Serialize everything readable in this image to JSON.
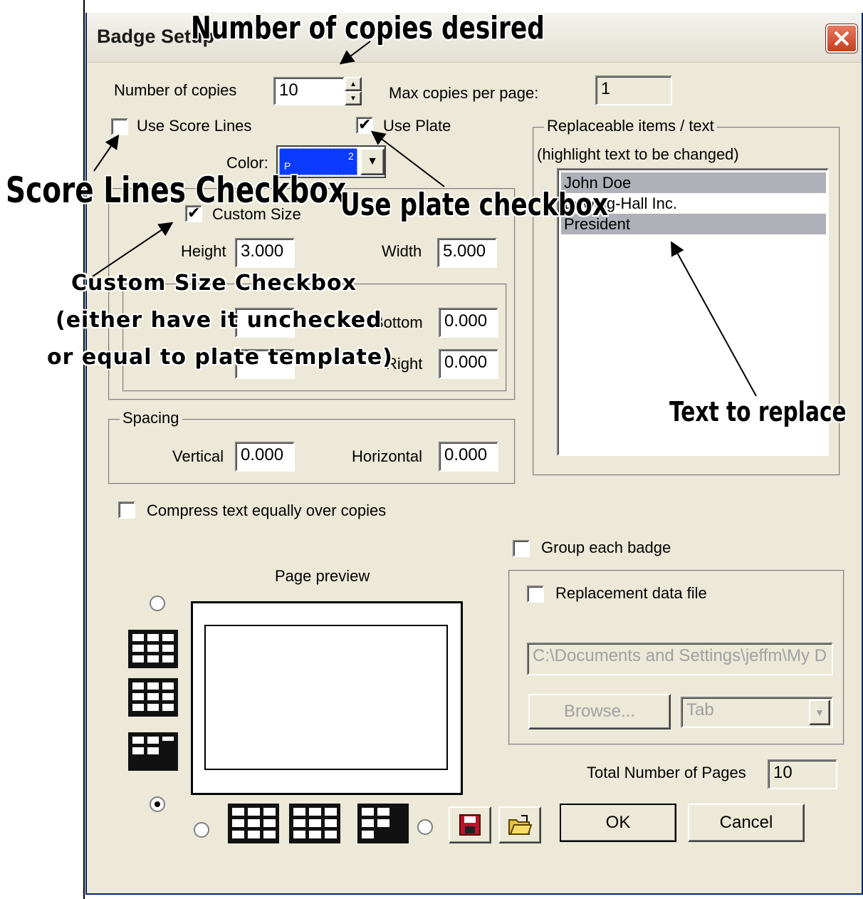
{
  "dialog": {
    "title": "Badge Setup",
    "close_icon": "close-x-icon"
  },
  "copies": {
    "label": "Number of copies",
    "value": "10",
    "max_label": "Max copies per page:",
    "max_value": "1"
  },
  "score_lines": {
    "label": "Use Score Lines",
    "checked": false
  },
  "use_plate": {
    "label": "Use Plate",
    "checked": true
  },
  "color": {
    "label": "Color:",
    "swatch_letter": "P",
    "swatch_number": "2",
    "swatch_color": "#0a3bff"
  },
  "size": {
    "custom_size_label": "Custom Size",
    "custom_size_checked": true,
    "height_label": "Height",
    "height_value": "3.000",
    "width_label": "Width",
    "width_value": "5.000",
    "bottom_label": "Bottom",
    "bottom_value": "0.000",
    "right_label": "Right",
    "right_value": "0.000"
  },
  "spacing": {
    "legend": "Spacing",
    "vertical_label": "Vertical",
    "vertical_value": "0.000",
    "horizontal_label": "Horizontal",
    "horizontal_value": "0.000"
  },
  "replaceable": {
    "legend": "Replaceable items / text",
    "hint": "(highlight text to be changed)",
    "items": [
      "John Doe",
      "Bowing-Hall Inc.",
      "President"
    ]
  },
  "compress": {
    "label": "Compress text equally over copies",
    "checked": false
  },
  "group_badge": {
    "label": "Group each badge",
    "checked": false
  },
  "replacement": {
    "label": "Replacement data file",
    "checked": false,
    "path": "C:\\Documents and Settings\\jeffm\\My D",
    "browse_label": "Browse...",
    "delimiter": "Tab"
  },
  "preview": {
    "label": "Page preview"
  },
  "pages": {
    "label": "Total Number of Pages",
    "value": "10"
  },
  "buttons": {
    "ok": "OK",
    "cancel": "Cancel",
    "save_icon": "save-floppy-icon",
    "open_icon": "open-folder-icon"
  },
  "annotations": {
    "copies": "Number of copies desired",
    "score_lines": "Score Lines Checkbox",
    "use_plate": "Use plate checkbox",
    "custom_size_1": "Custom Size Checkbox",
    "custom_size_2": "(either have it unchecked",
    "custom_size_3": "or equal to plate template)",
    "text_replace": "Text to replace"
  }
}
